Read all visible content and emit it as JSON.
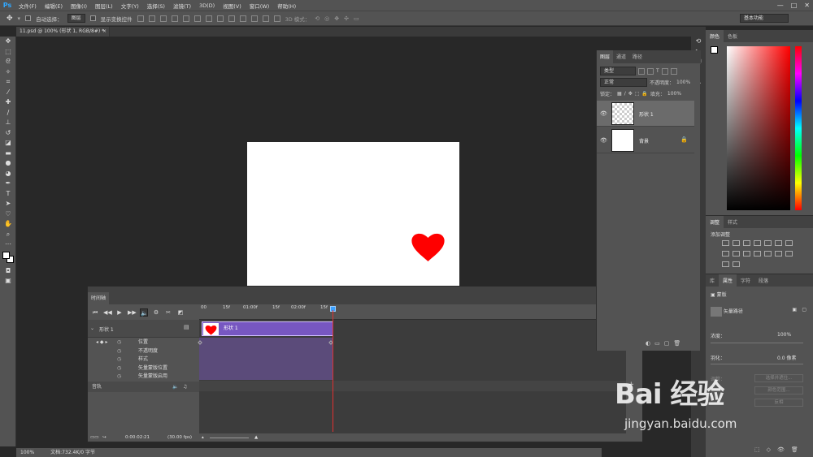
{
  "menubar": {
    "logo": "Ps",
    "items": [
      "文件(F)",
      "编辑(E)",
      "图像(I)",
      "图层(L)",
      "文字(Y)",
      "选择(S)",
      "滤镜(T)",
      "3D(D)",
      "视图(V)",
      "窗口(W)",
      "帮助(H)"
    ],
    "window_controls": [
      "—",
      "□",
      "✕"
    ]
  },
  "options": {
    "auto_select_label": "自动选择：",
    "auto_select_value": "图层",
    "show_transform_label": "显示变换控件",
    "mode_label": "3D 模式：",
    "workspace": "基本功能"
  },
  "document": {
    "tab_title": "11.psd @ 100% (形状 1, RGB/8#) *",
    "close": "×",
    "zoom": "100%",
    "doc_info": "文档:732.4K/0 字节"
  },
  "timeline": {
    "title": "时间轴",
    "layer_name": "形状 1",
    "clip_name": "形状 1",
    "properties": [
      "位置",
      "不透明度",
      "样式",
      "矢量蒙版位置",
      "矢量蒙版启用"
    ],
    "audio_track": "音轨",
    "ruler_labels": [
      "00",
      "15f",
      "01:00f",
      "15f",
      "02:00f",
      "15f"
    ],
    "current_time": "0:00:02:21",
    "fps": "(30.00 fps)",
    "add_label": "+"
  },
  "layers_panel": {
    "tabs": [
      "图层",
      "通道",
      "路径"
    ],
    "filter_type": "类型",
    "blend_mode": "正常",
    "opacity_label": "不透明度：",
    "opacity_value": "100%",
    "lock_label": "锁定：",
    "fill_label": "填充：",
    "fill_value": "100%",
    "layers": [
      {
        "name": "形状 1"
      },
      {
        "name": "背景"
      }
    ]
  },
  "color_panel": {
    "tabs": [
      "颜色",
      "色板"
    ]
  },
  "adjust_panel": {
    "tabs": [
      "调整",
      "样式"
    ],
    "label": "添加调整"
  },
  "props_panel": {
    "tabs": [
      "库",
      "属性",
      "字符",
      "段落"
    ],
    "type": "蒙版",
    "kind": "矢量路径",
    "density_label": "浓度：",
    "density_value": "100%",
    "feather_label": "羽化：",
    "feather_value": "0.0 像素",
    "refine_label": "调整：",
    "btn_select_mask": "选择并遮住...",
    "btn_color_range": "颜色范围...",
    "btn_invert": "反相"
  },
  "watermark": {
    "logo": "Bai 经验",
    "url": "jingyan.baidu.com"
  },
  "colors": {
    "heart": "#ff0000",
    "clip": "#7757c1",
    "playhead": "#e03030"
  }
}
